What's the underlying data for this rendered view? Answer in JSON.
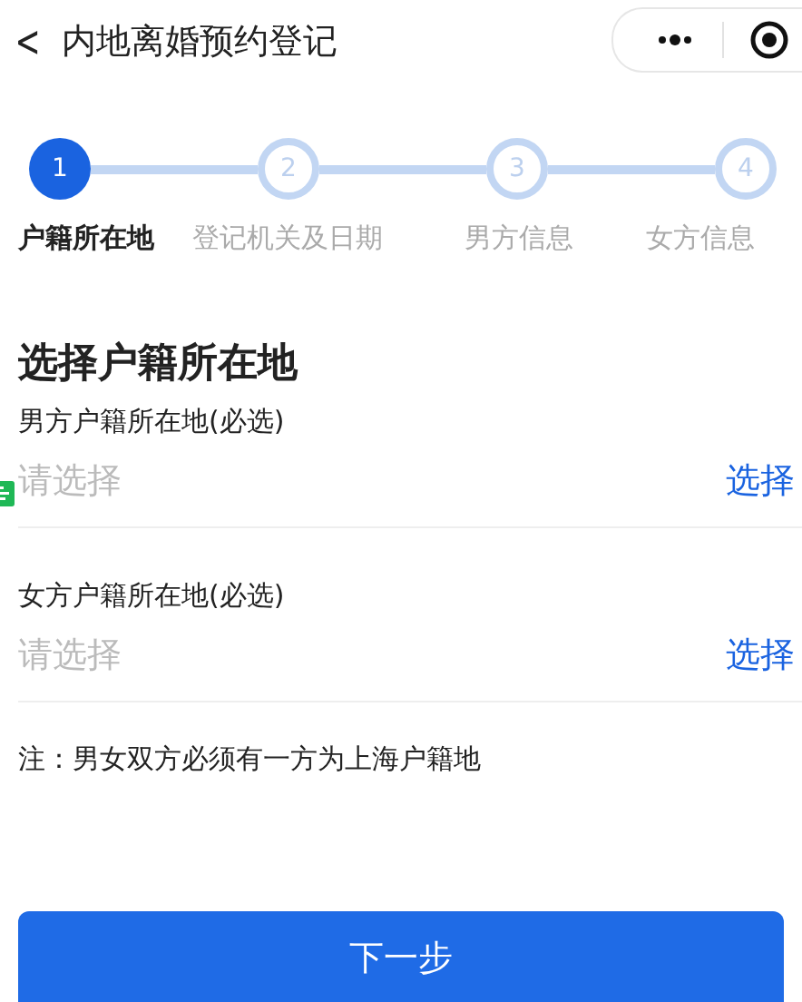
{
  "header": {
    "back": "<",
    "title": "内地离婚预约登记"
  },
  "steps": [
    {
      "number": "1",
      "label": "户籍所在地",
      "selected": true
    },
    {
      "number": "2",
      "label": "登记机关及日期",
      "selected": false
    },
    {
      "number": "3",
      "label": "男方信息",
      "selected": false
    },
    {
      "number": "4",
      "label": "女方信息",
      "selected": false
    }
  ],
  "section_title": "选择户籍所在地",
  "fields": [
    {
      "label": "男方户籍所在地(必选)",
      "placeholder": "请选择",
      "action": "选择"
    },
    {
      "label": "女方户籍所在地(必选)",
      "placeholder": "请选择",
      "action": "选择"
    }
  ],
  "note": "注：男女双方必须有一方为上海户籍地",
  "next_button": "下一步"
}
